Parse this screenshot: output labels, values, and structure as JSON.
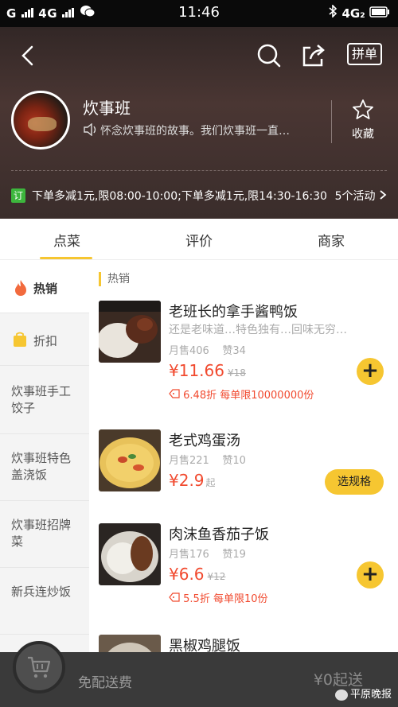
{
  "status_bar": {
    "signal_left": "G⩽⩽ 4G",
    "carrier_text": "G",
    "network": "4G",
    "time": "11:46",
    "network_right": "4G₂"
  },
  "header": {
    "group_label": "拼单",
    "shop_name": "炊事班",
    "notice": "怀念炊事班的故事。我们炊事班一直…",
    "favorite_label": "收藏"
  },
  "promo": {
    "tag": "订",
    "text": "下单多减1元,限08:00-10:00;下单多减1元,限14:30-16:30",
    "activity_count": "5个活动"
  },
  "tabs": [
    {
      "label": "点菜"
    },
    {
      "label": "评价"
    },
    {
      "label": "商家"
    }
  ],
  "sidebar": {
    "items": [
      {
        "label": "热销",
        "icon": "fire-icon"
      },
      {
        "label": "折扣",
        "icon": "discount-bag-icon"
      },
      {
        "label": "炊事班手工饺子"
      },
      {
        "label": "炊事班特色盖浇饭"
      },
      {
        "label": "炊事班招牌菜"
      },
      {
        "label": "新兵连炒饭"
      }
    ]
  },
  "section_title": "热销",
  "foods": [
    {
      "name": "老班长的拿手酱鸭饭",
      "desc": "还是老味道…特色独有…回味无穷…",
      "monthly_sales": "月售406",
      "likes": "赞34",
      "price": "¥11.66",
      "original_price": "¥18",
      "discount": "6.48折 每单限10000000份",
      "action": "+"
    },
    {
      "name": "老式鸡蛋汤",
      "monthly_sales": "月售221",
      "likes": "赞10",
      "price": "¥2.9",
      "price_suffix": "起",
      "action": "选规格"
    },
    {
      "name": "肉沫鱼香茄子饭",
      "monthly_sales": "月售176",
      "likes": "赞19",
      "price": "¥6.6",
      "original_price": "¥12",
      "discount": "5.5折 每单限10份",
      "action": "+"
    },
    {
      "name": "黑椒鸡腿饭"
    }
  ],
  "bottom_bar": {
    "delivery_text": "免配送费",
    "min_order_text": "¥0起送",
    "watermark": "平原晚报"
  },
  "colors": {
    "accent": "#f6c631",
    "price": "#f14a2f",
    "promo_tag": "#3db63d"
  }
}
